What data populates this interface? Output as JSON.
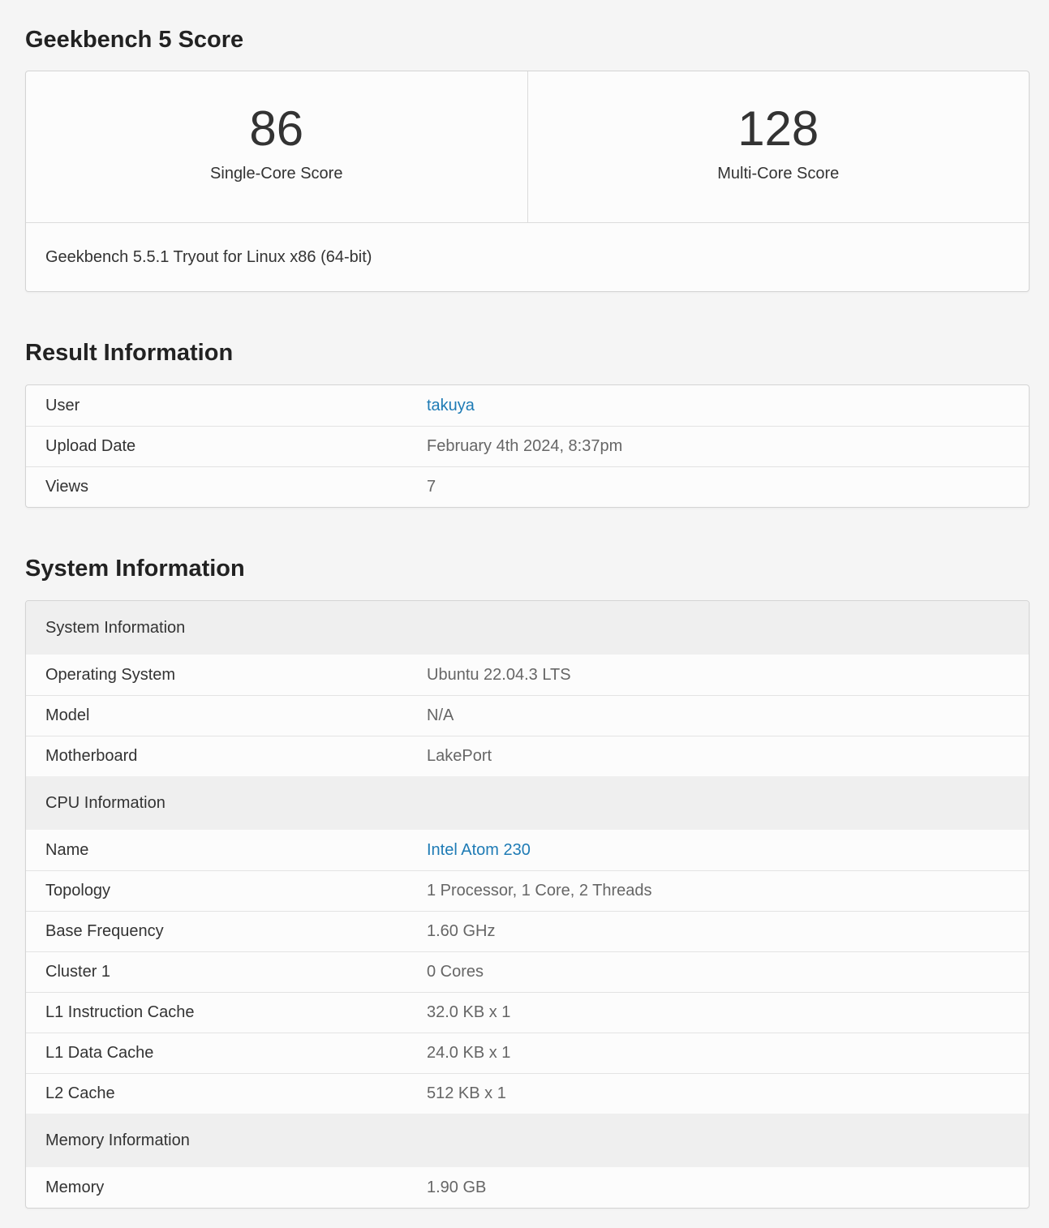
{
  "score_section": {
    "title": "Geekbench 5 Score",
    "single_core": {
      "value": "86",
      "label": "Single-Core Score"
    },
    "multi_core": {
      "value": "128",
      "label": "Multi-Core Score"
    },
    "version": "Geekbench 5.5.1 Tryout for Linux x86 (64-bit)"
  },
  "result_section": {
    "title": "Result Information",
    "rows": [
      {
        "key": "User",
        "value": "takuya"
      },
      {
        "key": "Upload Date",
        "value": "February 4th 2024, 8:37pm"
      },
      {
        "key": "Views",
        "value": "7"
      }
    ]
  },
  "system_section": {
    "title": "System Information",
    "groups": [
      {
        "header": "System Information",
        "rows": [
          {
            "key": "Operating System",
            "value": "Ubuntu 22.04.3 LTS"
          },
          {
            "key": "Model",
            "value": "N/A"
          },
          {
            "key": "Motherboard",
            "value": "LakePort"
          }
        ]
      },
      {
        "header": "CPU Information",
        "rows": [
          {
            "key": "Name",
            "value": "Intel Atom 230"
          },
          {
            "key": "Topology",
            "value": "1 Processor, 1 Core, 2 Threads"
          },
          {
            "key": "Base Frequency",
            "value": "1.60 GHz"
          },
          {
            "key": "Cluster 1",
            "value": "0 Cores"
          },
          {
            "key": "L1 Instruction Cache",
            "value": "32.0 KB x 1"
          },
          {
            "key": "L1 Data Cache",
            "value": "24.0 KB x 1"
          },
          {
            "key": "L2 Cache",
            "value": "512 KB x 1"
          }
        ]
      },
      {
        "header": "Memory Information",
        "rows": [
          {
            "key": "Memory",
            "value": "1.90 GB"
          }
        ]
      }
    ]
  },
  "colors": {
    "link": "#1e7bb5",
    "background": "#f5f5f5",
    "card": "#fcfcfc",
    "group_header": "#efefef"
  }
}
